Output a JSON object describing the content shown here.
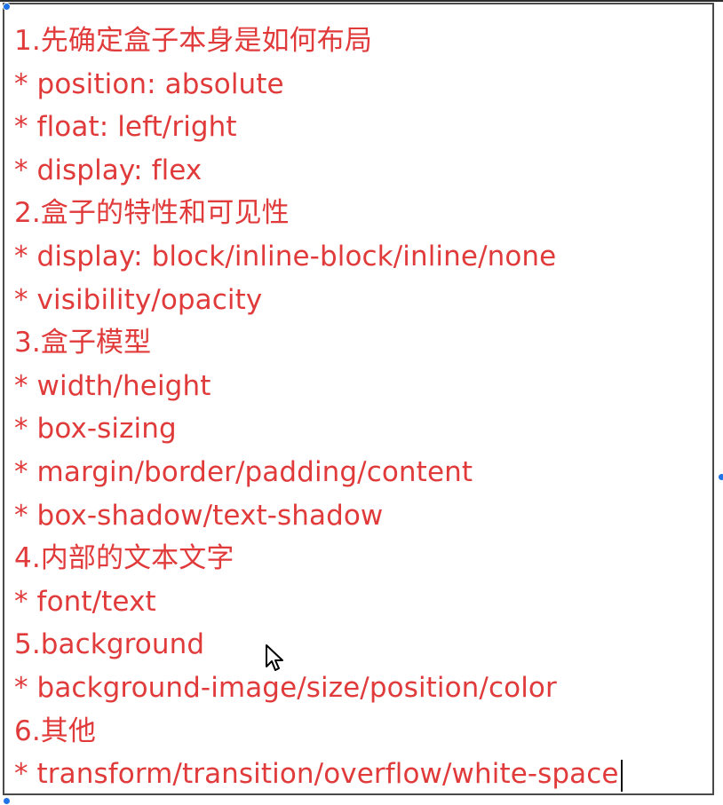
{
  "editor": {
    "lines": [
      "1.先确定盒子本身是如何布局",
      "* position: absolute",
      "* float: left/right",
      "* display: flex",
      "2.盒子的特性和可见性",
      "* display: block/inline-block/inline/none",
      "* visibility/opacity",
      "3.盒子模型",
      "* width/height",
      "* box-sizing",
      "* margin/border/padding/content",
      "* box-shadow/text-shadow",
      "4.内部的文本文字",
      "* font/text",
      "5.background",
      "* background-image/size/position/color",
      "6.其他",
      "* transform/transition/overflow/white-space"
    ],
    "text_color": "#e03a3a"
  },
  "icons": {
    "cursor": "mouse-pointer-icon",
    "handles": "resize-handle-icon"
  }
}
